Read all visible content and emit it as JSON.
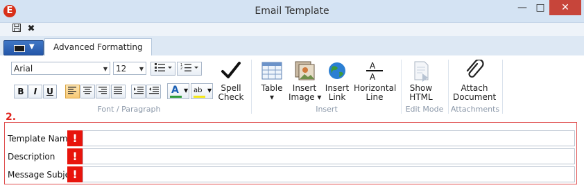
{
  "window": {
    "title": "Email Template",
    "app_icon": "E"
  },
  "quick_access": {
    "save_icon": "floppy-icon",
    "close_icon": "close-icon"
  },
  "tabs": [
    {
      "label": "Advanced Formatting",
      "active": true
    }
  ],
  "font_paragraph": {
    "font_name": "Arial",
    "font_size": "12",
    "bold": "B",
    "italic": "I",
    "underline": "U",
    "font_color_glyph": "A",
    "highlight_glyph": "ab",
    "group_label": "Font / Paragraph"
  },
  "spell_check": {
    "line1": "Spell",
    "line2": "Check"
  },
  "insert": {
    "table": {
      "line1": "Table",
      "line2": "▾"
    },
    "insert_image": {
      "line1": "Insert",
      "line2": "Image ▾"
    },
    "insert_link": {
      "line1": "Insert",
      "line2": "Link"
    },
    "horizontal_line": {
      "line1": "Horizontal",
      "line2": "Line"
    },
    "group_label": "Insert"
  },
  "edit_mode": {
    "show_html": {
      "line1": "Show",
      "line2": "HTML"
    },
    "group_label": "Edit Mode"
  },
  "attachments": {
    "attach_document": {
      "line1": "Attach",
      "line2": "Document"
    },
    "group_label": "Attachments"
  },
  "form": {
    "step": "2.",
    "required_mark": "!",
    "fields": [
      {
        "label": "Template Name",
        "value": ""
      },
      {
        "label": "Description",
        "value": ""
      },
      {
        "label": "Message Subject",
        "value": ""
      }
    ]
  },
  "colors": {
    "required": "#e8140c",
    "accent": "#2456a8",
    "active_button": "#f7c873"
  }
}
